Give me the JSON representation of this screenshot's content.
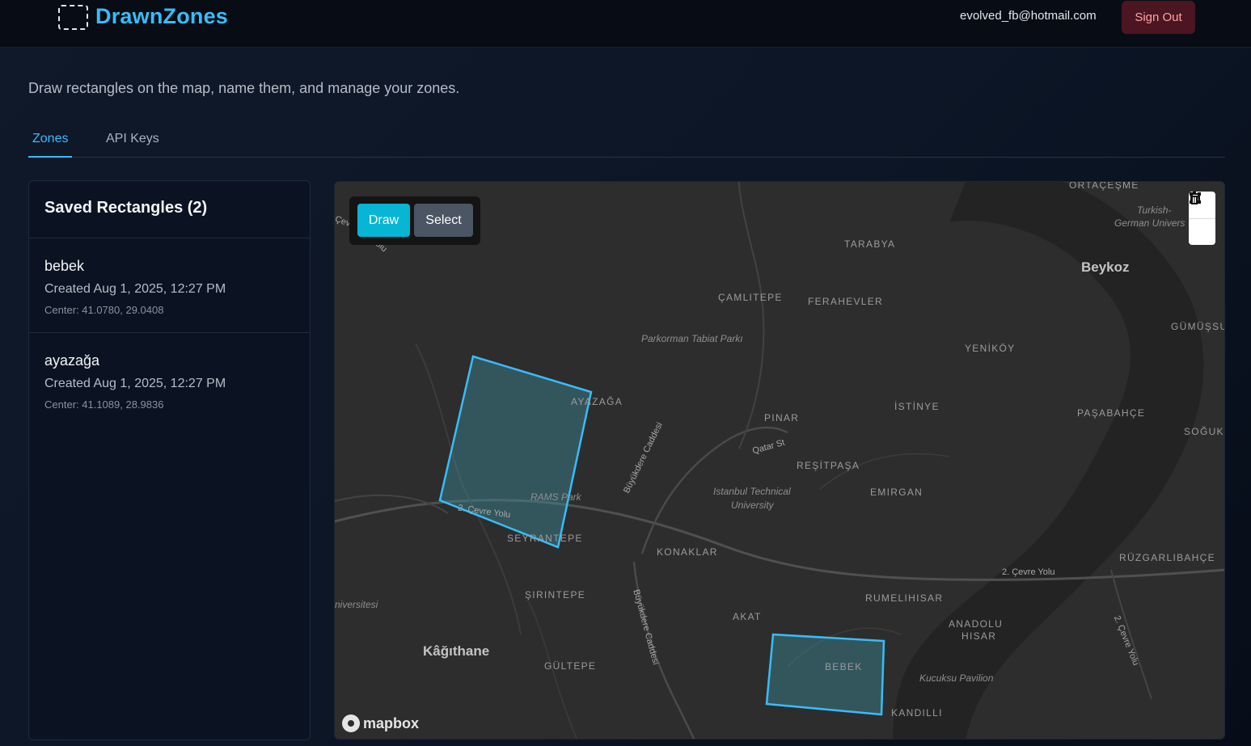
{
  "header": {
    "brand": "DrawnZones",
    "user_email": "evolved_fb@hotmail.com",
    "sign_out_label": "Sign Out"
  },
  "subtitle": "Draw rectangles on the map, name them, and manage your zones.",
  "tabs": [
    {
      "label": "Zones",
      "active": true
    },
    {
      "label": "API Keys",
      "active": false
    }
  ],
  "sidebar": {
    "title": "Saved Rectangles (2)",
    "zones": [
      {
        "name": "bebek",
        "created": "Created Aug 1, 2025, 12:27 PM",
        "center": "Center: 41.0780, 29.0408"
      },
      {
        "name": "ayazağa",
        "created": "Created Aug 1, 2025, 12:27 PM",
        "center": "Center: 41.1089, 28.9836"
      }
    ]
  },
  "map": {
    "draw_label": "Draw",
    "select_label": "Select",
    "attribution": "mapbox",
    "controls": [
      "polygon-icon",
      "trash-icon"
    ],
    "colors": {
      "accent": "#06b6d4",
      "zone_stroke": "#38bdf8",
      "zone_fill": "#3b8a9a"
    },
    "labels": {
      "ortacesme": "ORTAÇEŞME",
      "turkish_german": "Turkish-",
      "turkish_german2": "German Univers",
      "tarabya": "TARABYA",
      "beykoz": "Beykoz",
      "camlitepe": "ÇAMLITEPE",
      "ferahevler": "FERAHEVLER",
      "gumussu": "GÜMÜŞSU",
      "parkorman": "Parkorman Tabiat Parkı",
      "yenikoy": "YENİKÖY",
      "ayazaga": "AYAZAĞA",
      "istinye": "İSTİNYE",
      "pinar": "PINAR",
      "pasabahce": "PAŞABAHÇE",
      "soguksu": "SOĞUKS",
      "qatar": "Qatar St",
      "resitpasa": "REŞİTPAŞA",
      "itu": "Istanbul Technical",
      "itu2": "University",
      "emirgan": "EMIRGAN",
      "buyukdere1": "Büyükdere Caddesi",
      "rams": "RAMS Park",
      "cevre1": "2. Çevre Yolu",
      "seyrantepe": "SEYRANTEPE",
      "konaklar": "KONAKLAR",
      "rumelihisar": "RUMELIHISAR",
      "ruzgarlibahce": "RÜZGARLIBAHÇE",
      "cevre2": "2. Çevre Yolu",
      "sirintepe": "ŞIRINTEPE",
      "universitesi": "niversitesi",
      "akat": "AKAT",
      "anadolu": "ANADOLU",
      "hisar": "HISAR",
      "kagithane": "Kâğıthane",
      "gultepe": "GÜLTEPE",
      "bebek": "BEBEK",
      "kucuksu": "Kucuksu Pavilion",
      "kandilli": "KANDILLI",
      "buyukdere2": "Büyükdere Caddesi",
      "cevre3": "2. Çevre Yolu",
      "cev_topleft": "Çev",
      "olu": "olu"
    }
  }
}
